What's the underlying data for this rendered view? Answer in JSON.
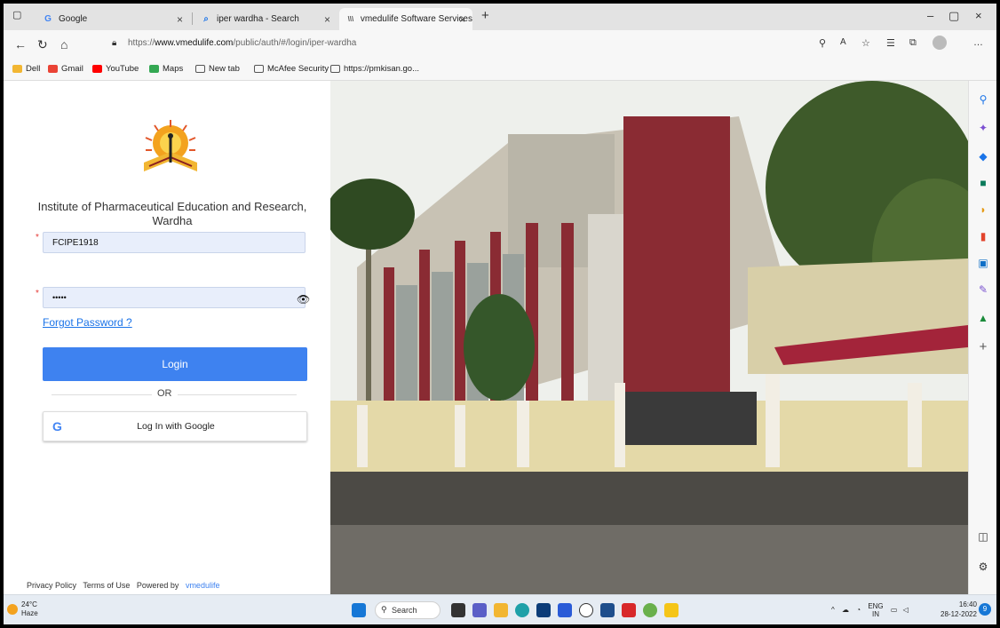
{
  "browser": {
    "tabs": [
      {
        "label": "Google",
        "icon": "google-icon"
      },
      {
        "label": "iper wardha - Search",
        "icon": "search-icon"
      },
      {
        "label": "vmedulife Software Services",
        "icon": "vmedulife-icon"
      }
    ],
    "url_prefix": "https://",
    "url_domain": "www.vmedulife.com",
    "url_path": "/public/auth/#/login/iper-wardha",
    "bookmarks": [
      "Dell",
      "Gmail",
      "YouTube",
      "Maps",
      "New tab",
      "McAfee Security",
      "https://pmkisan.go..."
    ]
  },
  "login": {
    "institute": "Institute of Pharmaceutical Education and Research, Wardha",
    "username_value": "FCIPE1918",
    "password_value": "•••••",
    "forgot_label": "Forgot Password ?",
    "login_label": "Login",
    "or_label": "OR",
    "google_label": "Log In with Google",
    "google_letter": "G"
  },
  "footer": {
    "privacy": "Privacy Policy",
    "terms": "Terms of Use",
    "powered": "Powered by",
    "brand": "vmedulife"
  },
  "taskbar": {
    "temp": "24°C",
    "weather": "Haze",
    "search_label": "Search",
    "lang": "ENG",
    "region": "IN",
    "time": "16:40",
    "date": "28-12-2022",
    "notif_count": "9"
  },
  "colors": {
    "accent": "#3e82f0",
    "link": "#1a73e8",
    "required": "#e53935"
  }
}
